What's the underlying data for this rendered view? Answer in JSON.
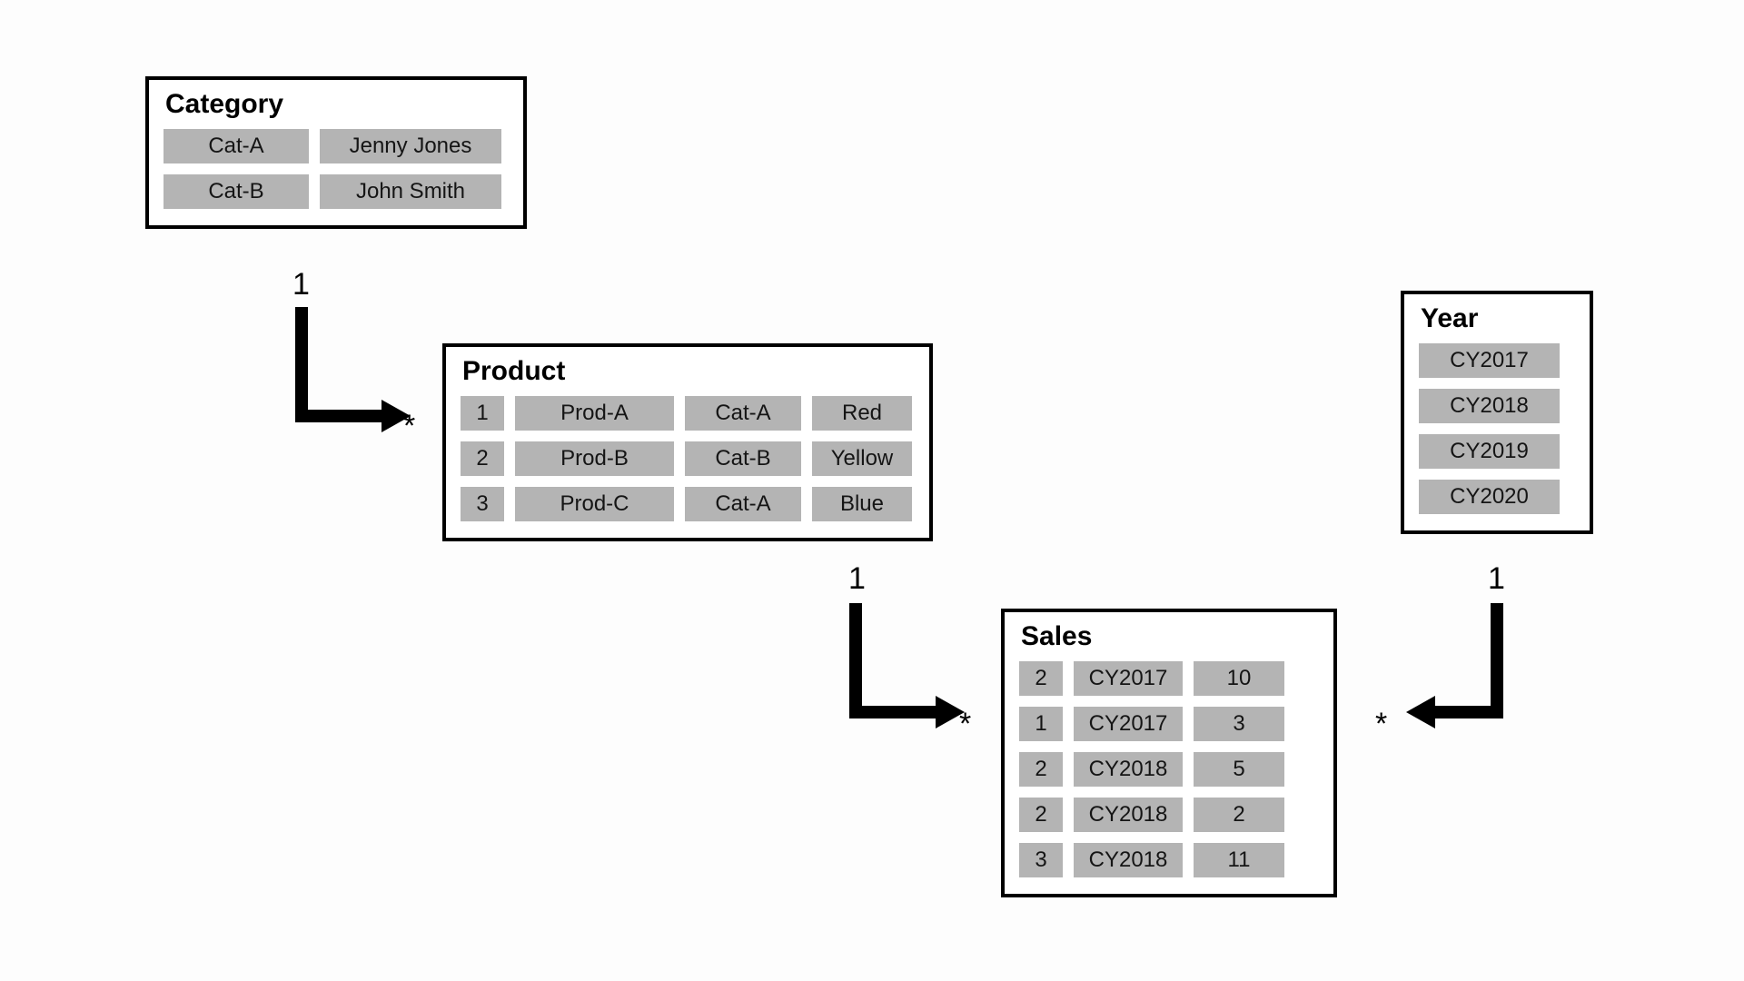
{
  "entities": {
    "category": {
      "title": "Category",
      "rows": [
        [
          "Cat-A",
          "Jenny Jones"
        ],
        [
          "Cat-B",
          "John Smith"
        ]
      ]
    },
    "product": {
      "title": "Product",
      "rows": [
        [
          "1",
          "Prod-A",
          "Cat-A",
          "Red"
        ],
        [
          "2",
          "Prod-B",
          "Cat-B",
          "Yellow"
        ],
        [
          "3",
          "Prod-C",
          "Cat-A",
          "Blue"
        ]
      ]
    },
    "sales": {
      "title": "Sales",
      "rows": [
        [
          "2",
          "CY2017",
          "10"
        ],
        [
          "1",
          "CY2017",
          "3"
        ],
        [
          "2",
          "CY2018",
          "5"
        ],
        [
          "2",
          "CY2018",
          "2"
        ],
        [
          "3",
          "CY2018",
          "11"
        ]
      ]
    },
    "year": {
      "title": "Year",
      "rows": [
        [
          "CY2017"
        ],
        [
          "CY2018"
        ],
        [
          "CY2019"
        ],
        [
          "CY2020"
        ]
      ]
    }
  },
  "relations": {
    "category_product": {
      "from_card": "1",
      "to_card": "*"
    },
    "product_sales": {
      "from_card": "1",
      "to_card": "*"
    },
    "year_sales": {
      "from_card": "1",
      "to_card": "*"
    }
  }
}
